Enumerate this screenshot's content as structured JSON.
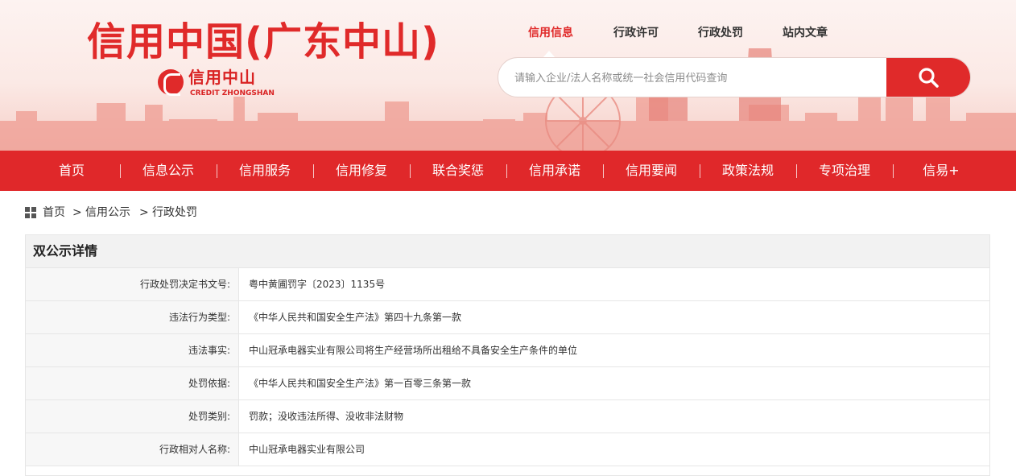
{
  "header": {
    "site_title": "信用中国(广东中山)",
    "logo_cn": "信用中山",
    "logo_en": "CREDIT ZHONGSHAN",
    "logo_icon": "credit-zhongshan-logo-icon",
    "top_tabs": [
      {
        "label": "信用信息",
        "active": true
      },
      {
        "label": "行政许可",
        "active": false
      },
      {
        "label": "行政处罚",
        "active": false
      },
      {
        "label": "站内文章",
        "active": false
      }
    ],
    "search": {
      "placeholder": "请输入企业/法人名称或统一社会信用代码查询",
      "value": "",
      "button_icon": "search-icon"
    }
  },
  "nav": {
    "items": [
      "首页",
      "信息公示",
      "信用服务",
      "信用修复",
      "联合奖惩",
      "信用承诺",
      "信用要闻",
      "政策法规",
      "专项治理",
      "信易+"
    ]
  },
  "breadcrumb": {
    "icon": "grid-icon",
    "items": [
      "首页",
      "信用公示",
      "行政处罚"
    ],
    "separator": ">"
  },
  "detail": {
    "title": "双公示详情",
    "rows": [
      {
        "label": "行政处罚决定书文号:",
        "value": "粤中黄圃罚字〔2023〕1135号"
      },
      {
        "label": "违法行为类型:",
        "value": "《中华人民共和国安全生产法》第四十九条第一款"
      },
      {
        "label": "违法事实:",
        "value": "中山冠承电器实业有限公司将生产经营场所出租给不具备安全生产条件的单位"
      },
      {
        "label": "处罚依据:",
        "value": "《中华人民共和国安全生产法》第一百零三条第一款"
      },
      {
        "label": "处罚类别:",
        "value": "罚款；没收违法所得、没收非法财物"
      },
      {
        "label": "行政相对人名称:",
        "value": "中山冠承电器实业有限公司"
      }
    ]
  },
  "colors": {
    "brand_red": "#e02a2a",
    "nav_red": "#e0282a",
    "label_bg": "#f7f7f7",
    "title_bg": "#f2f2f2"
  }
}
